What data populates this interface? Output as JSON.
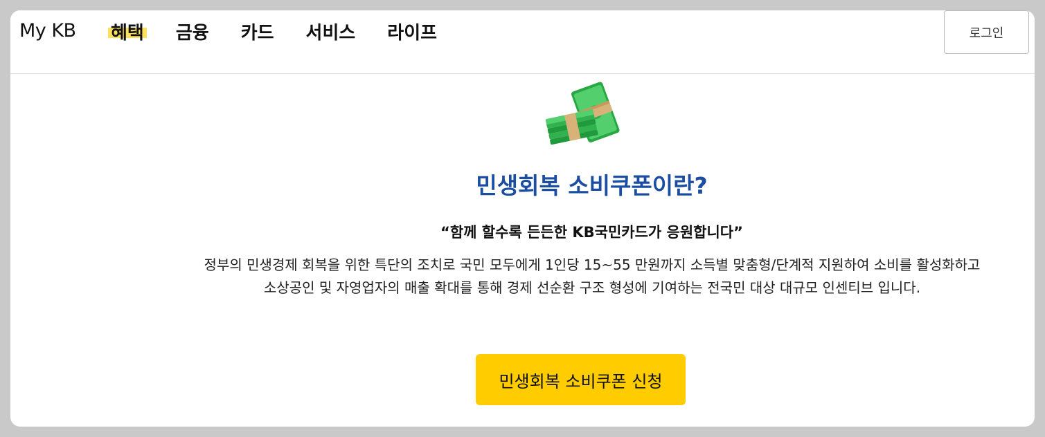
{
  "header": {
    "logo": "My KB",
    "nav": [
      {
        "label": "혜택",
        "active": true
      },
      {
        "label": "금융",
        "active": false
      },
      {
        "label": "카드",
        "active": false
      },
      {
        "label": "서비스",
        "active": false
      },
      {
        "label": "라이프",
        "active": false
      }
    ],
    "login_label": "로그인"
  },
  "main": {
    "icon": "money-stack-icon",
    "title": "민생회복 소비쿠폰이란?",
    "slogan": "“함께 할수록 든든한 KB국민카드가 응원합니다”",
    "description_line1": "정부의 민생경제 회복을 위한 특단의 조치로 국민 모두에게 1인당 15~55 만원까지 소득별 맞춤형/단계적 지원하여 소비를 활성화하고",
    "description_line2": "소상공인 및 자영업자의 매출 확대를 통해 경제 선순환 구조 형성에 기여하는 전국민 대상 대규모 인센티브 입니다.",
    "apply_label": "민생회복 소비쿠폰 신청"
  },
  "colors": {
    "title": "#1b4ea0",
    "accent_button": "#ffcc00",
    "nav_highlight": "#ffdf5e"
  }
}
